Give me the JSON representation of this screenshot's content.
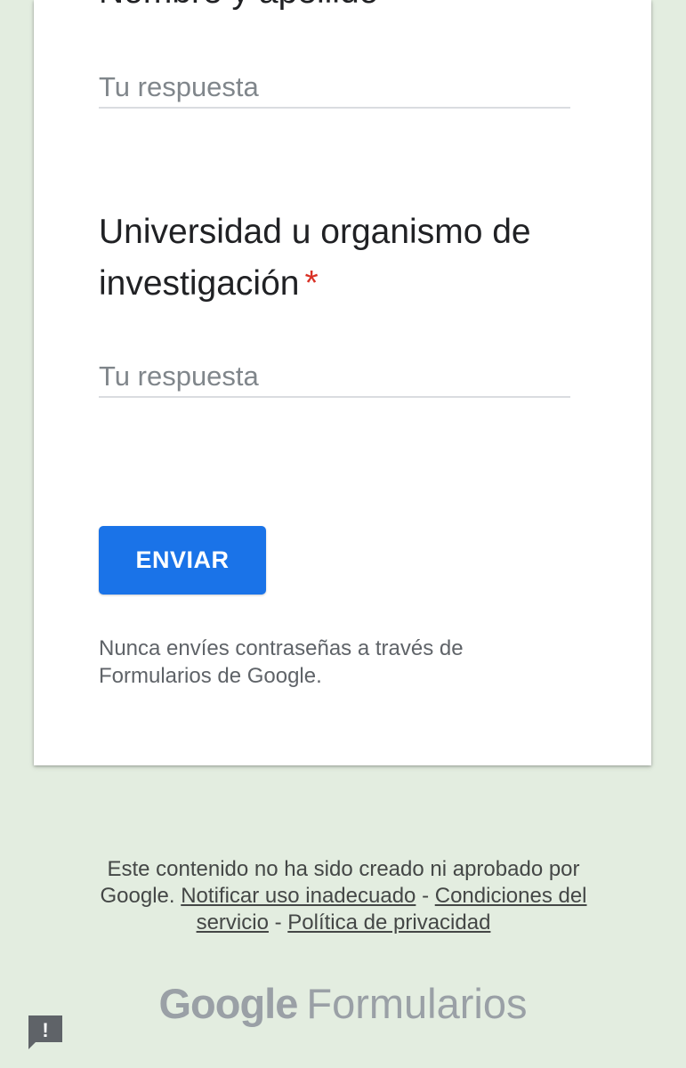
{
  "form": {
    "question1": {
      "title": "Nombre y apellido",
      "placeholder": "Tu respuesta"
    },
    "question2": {
      "title": "Universidad u organismo de investigación",
      "required_mark": "*",
      "placeholder": "Tu respuesta"
    },
    "submit_label": "ENVIAR",
    "password_warning": "Nunca envíes contraseñas a través de Formularios de Google."
  },
  "footer": {
    "disclaimer": "Este contenido no ha sido creado ni aprobado por Google.",
    "report_link": "Notificar uso inadecuado",
    "terms_link": "Condiciones del servicio",
    "privacy_link": "Política de privacidad",
    "separator": "-"
  },
  "branding": {
    "google": "Google",
    "product": "Formularios"
  },
  "report_button": {
    "icon": "feedback-report-icon",
    "glyph": "!"
  },
  "colors": {
    "background": "#e3ede0",
    "accent": "#1a73e8",
    "required": "#d93025"
  }
}
